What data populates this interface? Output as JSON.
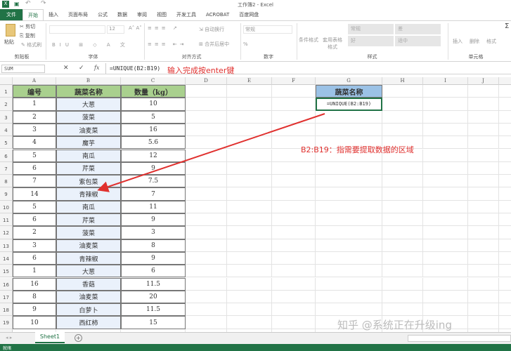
{
  "window": {
    "title": "工作簿2 - Excel"
  },
  "tabs": [
    "文件",
    "开始",
    "插入",
    "页面布局",
    "公式",
    "数据",
    "审阅",
    "视图",
    "开发工具",
    "ACROBAT",
    "百度网盘"
  ],
  "ribbon": {
    "clipboard": {
      "paste": "粘贴",
      "cut": "剪切",
      "copy": "复制",
      "format_painter": "格式刷",
      "label": "剪贴板"
    },
    "font": {
      "size": "12",
      "label": "字体"
    },
    "alignment": {
      "wrap": "自动换行",
      "merge": "合并后居中",
      "label": "对齐方式"
    },
    "number": {
      "format": "常规",
      "percent": "%",
      "label": "数字"
    },
    "styles": {
      "conditional": "条件格式",
      "table": "套用表格格式",
      "normal": "常规",
      "bad": "差",
      "good": "好",
      "neutral": "适中",
      "label": "样式"
    },
    "cells": {
      "insert": "插入",
      "delete": "删除",
      "format": "格式",
      "label": "单元格"
    },
    "editing": {
      "sum": "Σ"
    }
  },
  "formula_bar": {
    "name_box": "SUM",
    "cancel": "✕",
    "enter": "✓",
    "fx": "fx",
    "formula": "=UNIQUE(B2:B19)",
    "note": "输入完成按enter键"
  },
  "columns": [
    "A",
    "B",
    "C",
    "D",
    "E",
    "F",
    "G",
    "H",
    "I",
    "J",
    "K"
  ],
  "table": {
    "headers": [
      "编号",
      "蔬菜名称",
      "数量（kg）"
    ],
    "rows": [
      [
        "1",
        "大葱",
        "10"
      ],
      [
        "2",
        "菠菜",
        "5"
      ],
      [
        "3",
        "油麦菜",
        "16"
      ],
      [
        "4",
        "魔芋",
        "5.6"
      ],
      [
        "5",
        "南瓜",
        "12"
      ],
      [
        "6",
        "芹菜",
        "9"
      ],
      [
        "7",
        "紫包菜",
        "7.5"
      ],
      [
        "14",
        "青辣椒",
        "7"
      ],
      [
        "5",
        "南瓜",
        "11"
      ],
      [
        "6",
        "芹菜",
        "9"
      ],
      [
        "2",
        "菠菜",
        "3"
      ],
      [
        "3",
        "油麦菜",
        "8"
      ],
      [
        "6",
        "青辣椒",
        "9"
      ],
      [
        "1",
        "大葱",
        "6"
      ],
      [
        "16",
        "香菇",
        "11.5"
      ],
      [
        "8",
        "油麦菜",
        "20"
      ],
      [
        "9",
        "白萝卜",
        "11.5"
      ],
      [
        "10",
        "西红柿",
        "15"
      ]
    ]
  },
  "result": {
    "header": "蔬菜名称",
    "formula": "=UNIQUE(B2:B19)"
  },
  "annotation": "B2:B19：指需要提取数据的区域",
  "watermark": "知乎 @系统正在升级ing",
  "sheet_tab": "Sheet1",
  "status": "就绪",
  "colors": {
    "excel_green": "#217346",
    "header_green": "#a9d08e",
    "header_blue": "#9bc2e6",
    "range_fill": "#eaf1fb",
    "annotation_red": "#e0302e"
  }
}
